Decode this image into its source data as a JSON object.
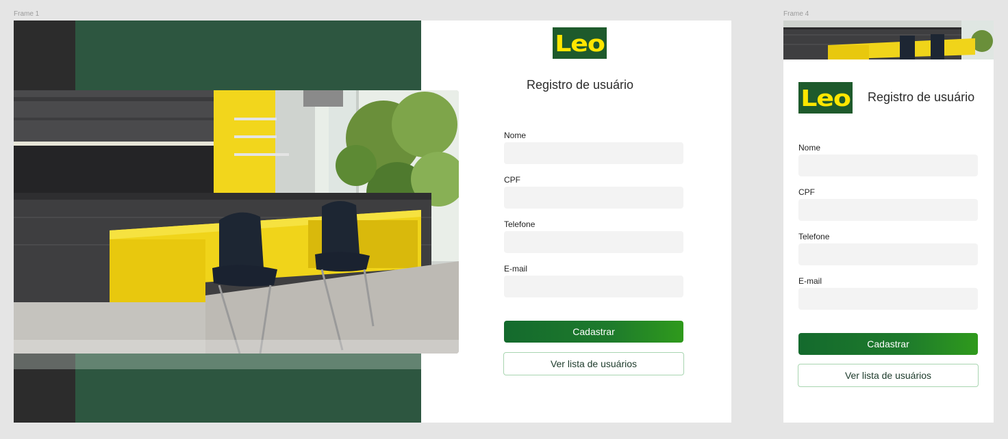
{
  "frame1": {
    "label": "Frame 1",
    "logo_text": "Leo",
    "title": "Registro de usuário",
    "fields": [
      {
        "label": "Nome",
        "value": ""
      },
      {
        "label": "CPF",
        "value": ""
      },
      {
        "label": "Telefone",
        "value": ""
      },
      {
        "label": "E-mail",
        "value": ""
      }
    ],
    "submit_label": "Cadastrar",
    "list_label": "Ver lista de usuários"
  },
  "frame4": {
    "label": "Frame 4",
    "logo_text": "Leo",
    "title": "Registro de usuário",
    "fields": [
      {
        "label": "Nome",
        "value": ""
      },
      {
        "label": "CPF",
        "value": ""
      },
      {
        "label": "Telefone",
        "value": ""
      },
      {
        "label": "E-mail",
        "value": ""
      }
    ],
    "submit_label": "Cadastrar",
    "list_label": "Ver lista de usuários"
  },
  "colors": {
    "brand_green": "#1e5a2c",
    "brand_yellow": "#ffe600",
    "panel_green": "#2d5640",
    "panel_dark": "#2c2c2c",
    "button_gradient_start": "#146a2d",
    "button_gradient_end": "#2f9a1c",
    "outline_border": "#a8d5b0"
  },
  "images": {
    "hero_photo": "kitchen-photo"
  }
}
